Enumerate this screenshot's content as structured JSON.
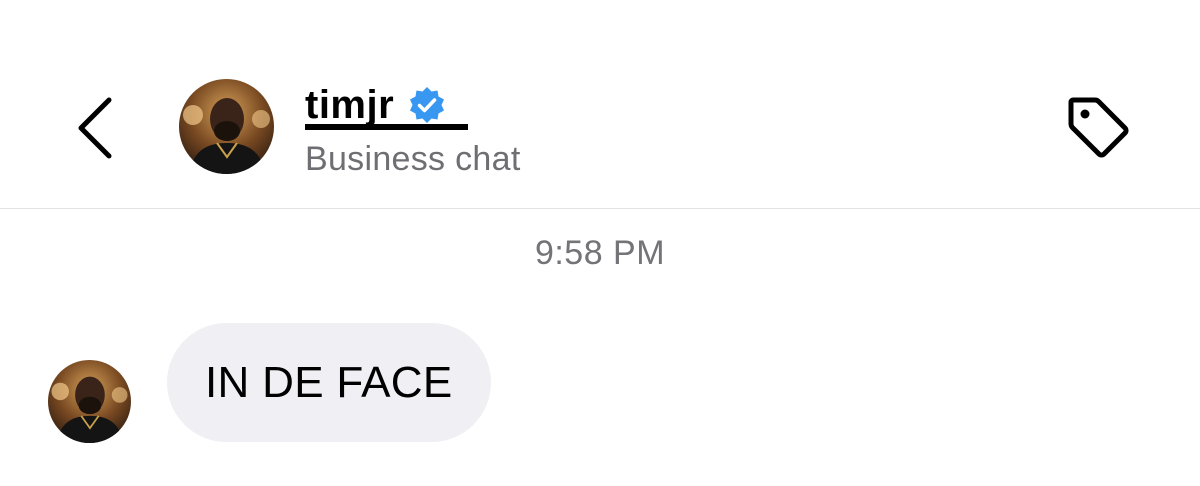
{
  "header": {
    "back_icon": "chevron-left-icon",
    "username": "timjr",
    "verified_icon": "verified-badge-icon",
    "subtitle": "Business chat",
    "tag_icon": "tag-icon",
    "avatar_icon": "profile-photo"
  },
  "thread": {
    "timestamp": "9:58 PM",
    "messages": [
      {
        "text": "IN DE FACE",
        "sender_avatar": "profile-photo"
      }
    ]
  },
  "colors": {
    "verified_blue": "#3897f0",
    "bubble_bg": "#efeff4",
    "subtitle_gray": "#6e6e73",
    "divider": "#e3e3e6"
  }
}
